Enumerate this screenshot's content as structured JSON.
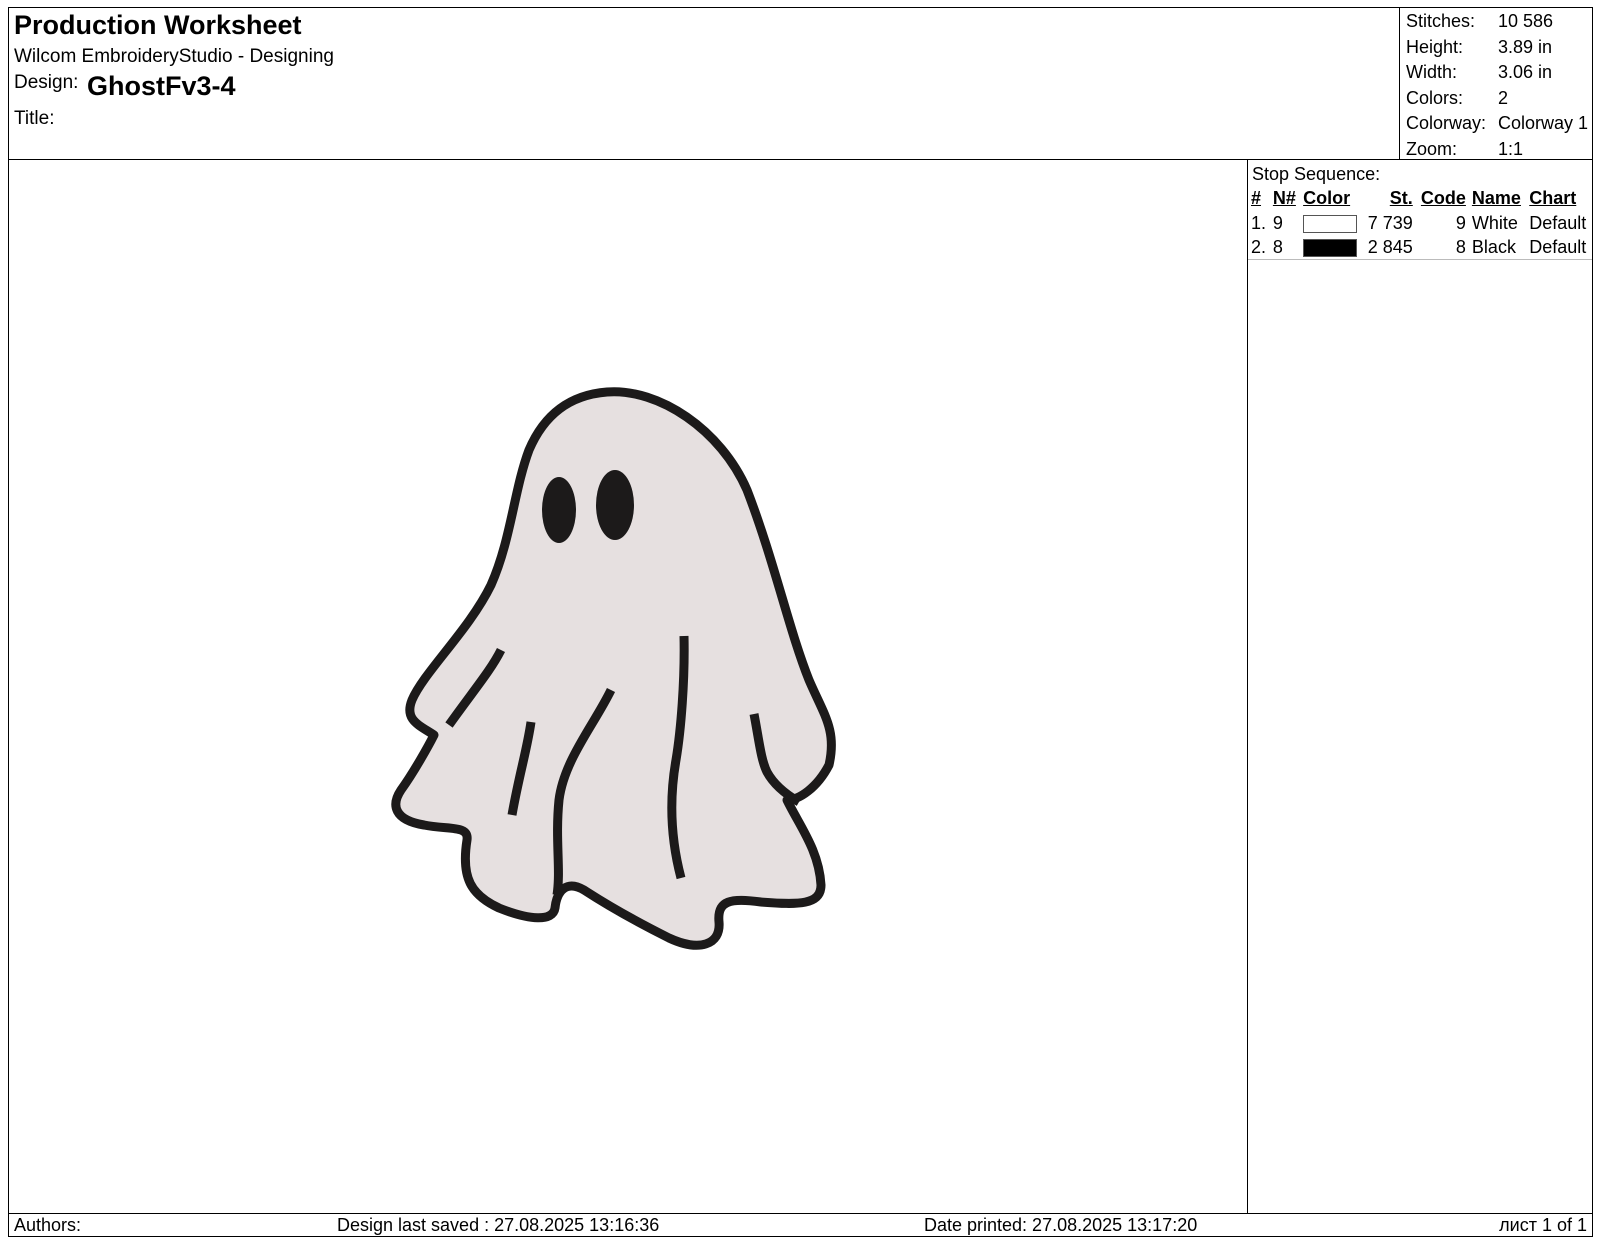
{
  "header": {
    "title": "Production Worksheet",
    "software": "Wilcom EmbroideryStudio - Designing",
    "design_label": "Design:",
    "design_name": "GhostFv3-4",
    "title_label": "Title:"
  },
  "stats": [
    {
      "label": "Stitches:",
      "value": "10 586"
    },
    {
      "label": "Height:",
      "value": "3.89 in"
    },
    {
      "label": "Width:",
      "value": "3.06 in"
    },
    {
      "label": "Colors:",
      "value": "2"
    },
    {
      "label": "Colorway:",
      "value": "Colorway 1"
    },
    {
      "label": "Zoom:",
      "value": "1:1"
    }
  ],
  "stop_sequence": {
    "title": "Stop Sequence:",
    "headers": {
      "num": "#",
      "n": "N#",
      "color": "Color",
      "st": "St.",
      "code": "Code",
      "name": "Name",
      "chart": "Chart"
    },
    "rows": [
      {
        "num": "1.",
        "n": "9",
        "swatch": "#ffffff",
        "st": "7 739",
        "code": "9",
        "name": "White",
        "chart": "Default"
      },
      {
        "num": "2.",
        "n": "8",
        "swatch": "#000000",
        "st": "2 845",
        "code": "8",
        "name": "Black",
        "chart": "Default"
      }
    ]
  },
  "design_colors": {
    "fill": "#e6e0e0",
    "outline": "#1c1a1a"
  },
  "footer": {
    "authors_label": "Authors:",
    "last_saved": "Design last saved : 27.08.2025 13:16:36",
    "date_printed": "Date printed: 27.08.2025 13:17:20",
    "page": "лист 1 of 1"
  }
}
